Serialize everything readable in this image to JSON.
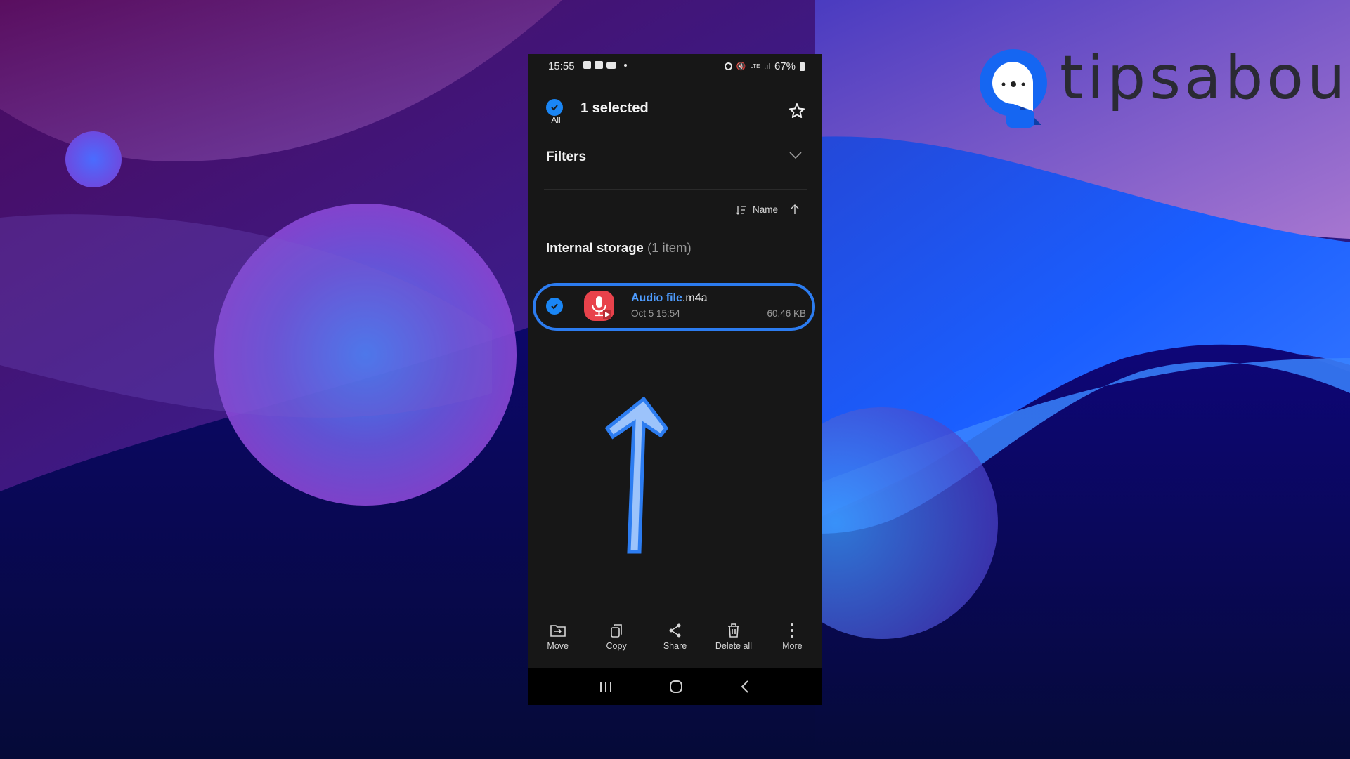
{
  "status_bar": {
    "time": "15:55",
    "notification_icons": [
      "gallery-icon",
      "teams-icon",
      "youtube-icon",
      "dot-icon"
    ],
    "system_icons": [
      "alarm-icon",
      "mute-icon",
      "lte-icon",
      "signal-icon"
    ],
    "battery": "67%"
  },
  "header": {
    "select_all_label": "All",
    "title": "1 selected",
    "favorite_icon": "star-icon"
  },
  "filters": {
    "label": "Filters",
    "expand_icon": "chevron-down-icon"
  },
  "sort": {
    "field": "Name",
    "direction_icon": "arrow-up-icon"
  },
  "section": {
    "title": "Internal storage",
    "count": "(1 item)"
  },
  "files": [
    {
      "name_highlight": "Audio file",
      "extension": ".m4a",
      "date": "Oct 5 15:54",
      "size": "60.46 KB",
      "selected": true,
      "icon": "voice-recorder-icon"
    }
  ],
  "toolbar": [
    {
      "label": "Move",
      "icon": "move-icon"
    },
    {
      "label": "Copy",
      "icon": "copy-icon"
    },
    {
      "label": "Share",
      "icon": "share-icon"
    },
    {
      "label": "Delete all",
      "icon": "trash-icon"
    },
    {
      "label": "More",
      "icon": "more-vertical-icon"
    }
  ],
  "navbar": [
    "recents-icon",
    "home-icon",
    "back-icon"
  ],
  "brand": {
    "name": "tipsabout",
    "accent": "#1a66ff"
  },
  "colors": {
    "highlight": "#2c7cf0",
    "checkbox": "#1a86f5",
    "file_icon": "#e8424b",
    "arrow_fill": "#9cc3fb",
    "arrow_stroke": "#2c7cf0"
  }
}
